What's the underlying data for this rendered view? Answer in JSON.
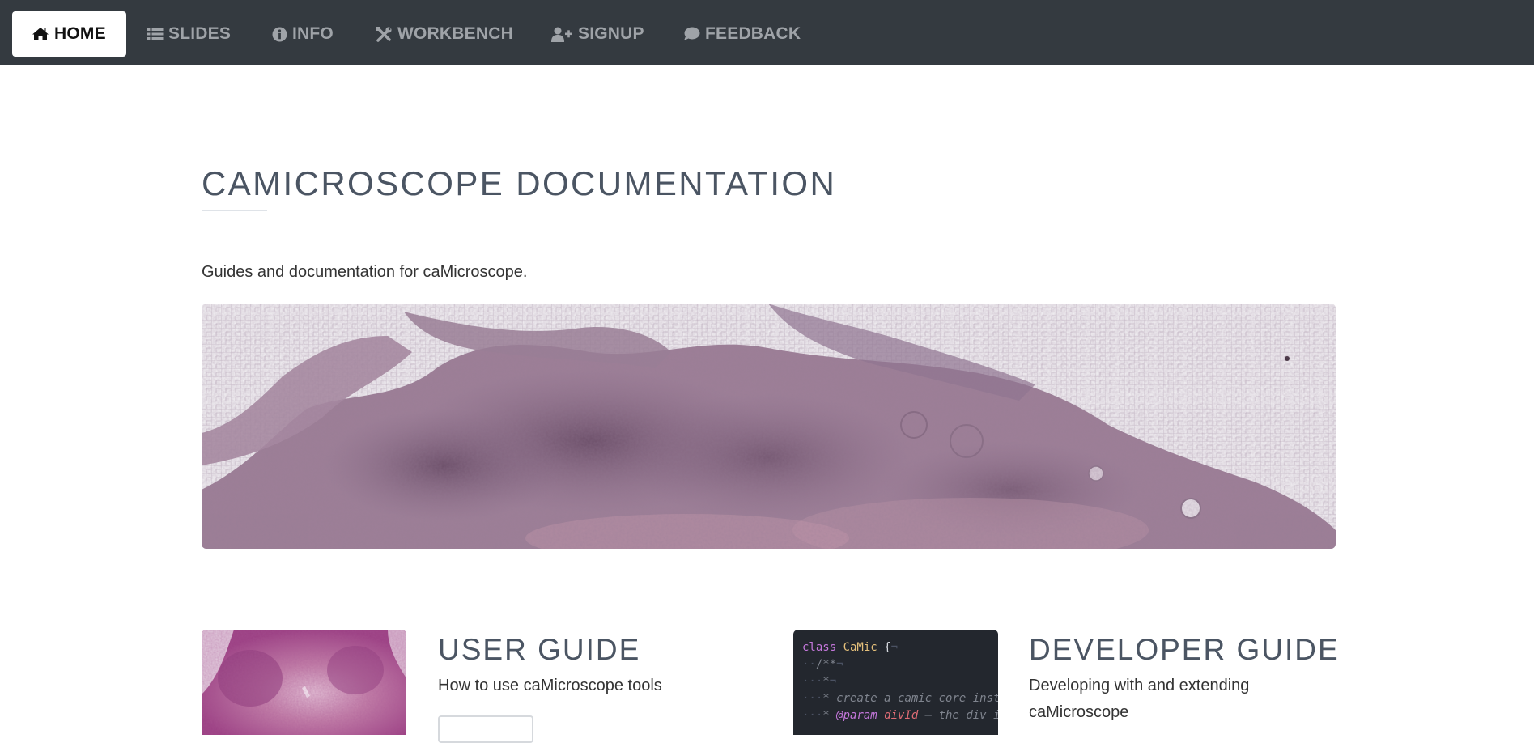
{
  "nav": {
    "items": [
      {
        "label": "HOME",
        "icon": "home-icon",
        "active": true
      },
      {
        "label": "SLIDES",
        "icon": "list-icon",
        "active": false
      },
      {
        "label": "INFO",
        "icon": "info-circle-icon",
        "active": false
      },
      {
        "label": "WORKBENCH",
        "icon": "tools-icon",
        "active": false
      },
      {
        "label": "SIGNUP",
        "icon": "user-plus-icon",
        "active": false
      },
      {
        "label": "FEEDBACK",
        "icon": "comment-icon",
        "active": false
      }
    ],
    "background": "#343a40",
    "text_color": "#9fa3a8",
    "active_text_color": "#111111"
  },
  "page": {
    "title": "CAMICROSCOPE DOCUMENTATION",
    "subtitle": "Guides and documentation for caMicroscope.",
    "heading_color": "#4b5563"
  },
  "cards": [
    {
      "title": "USER GUIDE",
      "description": "How to use caMicroscope tools",
      "image": "tissue-thumbnail"
    },
    {
      "title": "DEVELOPER GUIDE",
      "description": "Developing with and extending caMicroscope",
      "image": "code-thumbnail",
      "code_lines": [
        {
          "parts": [
            {
              "t": "class ",
              "c": "#c678dd"
            },
            {
              "t": "CaMic ",
              "c": "#e5c07b"
            },
            {
              "t": "{",
              "c": "#d7dae0"
            },
            {
              "t": "¬",
              "c": "#4b5263"
            }
          ]
        },
        {
          "parts": [
            {
              "t": "··",
              "c": "#4b5263"
            },
            {
              "t": "/**",
              "c": "#7f848e"
            },
            {
              "t": "¬",
              "c": "#4b5263"
            }
          ]
        },
        {
          "parts": [
            {
              "t": "···",
              "c": "#4b5263"
            },
            {
              "t": "*",
              "c": "#7f848e"
            },
            {
              "t": "¬",
              "c": "#4b5263"
            }
          ]
        },
        {
          "parts": [
            {
              "t": "···",
              "c": "#4b5263"
            },
            {
              "t": "* create a camic core instance",
              "c": "#7f848e"
            }
          ]
        },
        {
          "parts": [
            {
              "t": "···",
              "c": "#4b5263"
            },
            {
              "t": "* ",
              "c": "#7f848e"
            },
            {
              "t": "@param ",
              "c": "#c678dd"
            },
            {
              "t": "divId ",
              "c": "#e06c75"
            },
            {
              "t": "– the div id",
              "c": "#7f848e"
            }
          ]
        }
      ]
    }
  ],
  "hero": {
    "image": "whole-slide-tissue-banner"
  }
}
